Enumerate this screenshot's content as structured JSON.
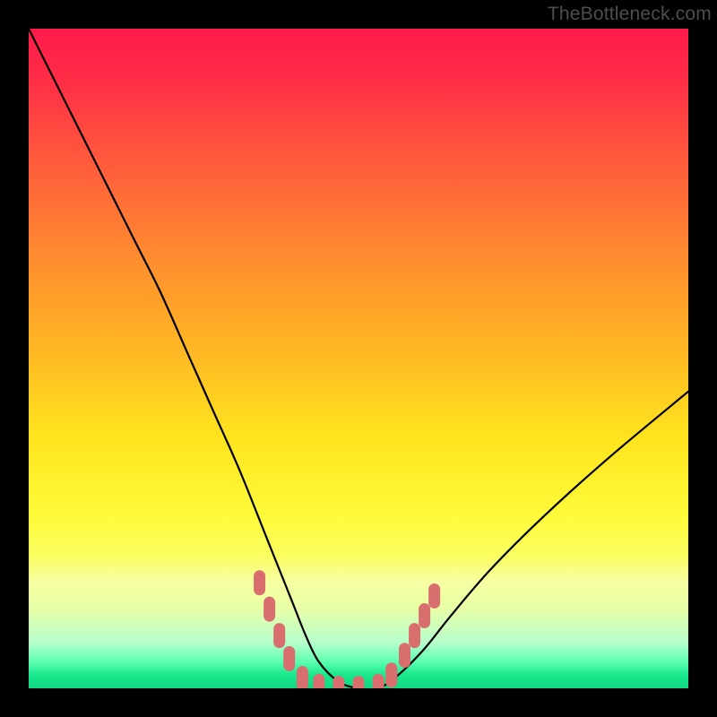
{
  "watermark": {
    "text": "TheBottleneck.com"
  },
  "chart_data": {
    "type": "line",
    "title": "",
    "xlabel": "",
    "ylabel": "",
    "xlim": [
      0,
      100
    ],
    "ylim": [
      0,
      100
    ],
    "grid": false,
    "legend": false,
    "series": [
      {
        "name": "bottleneck-curve",
        "x": [
          0,
          4,
          8,
          12,
          16,
          20,
          24,
          28,
          32,
          36,
          38,
          40,
          42,
          44,
          47,
          50,
          53,
          56,
          60,
          64,
          70,
          78,
          88,
          100
        ],
        "values": [
          100,
          92,
          84,
          76,
          68,
          60,
          51,
          42,
          33,
          23,
          18,
          13,
          8,
          4,
          1,
          0,
          0,
          2,
          6,
          11,
          18,
          26,
          35,
          45
        ]
      }
    ],
    "markers": {
      "name": "valley-markers",
      "color_hex": "#d96e6e",
      "points": [
        {
          "x": 35.0,
          "y": 16.0
        },
        {
          "x": 36.5,
          "y": 12.0
        },
        {
          "x": 38.0,
          "y": 8.0
        },
        {
          "x": 39.5,
          "y": 4.5
        },
        {
          "x": 41.5,
          "y": 1.5
        },
        {
          "x": 44.0,
          "y": 0.3
        },
        {
          "x": 47.0,
          "y": 0.0
        },
        {
          "x": 50.0,
          "y": 0.0
        },
        {
          "x": 53.0,
          "y": 0.3
        },
        {
          "x": 55.0,
          "y": 2.0
        },
        {
          "x": 57.0,
          "y": 5.0
        },
        {
          "x": 58.5,
          "y": 8.0
        },
        {
          "x": 60.0,
          "y": 11.0
        },
        {
          "x": 61.5,
          "y": 14.0
        }
      ]
    },
    "gradient_colors": {
      "top": "#ff1a4a",
      "mid": "#ffe41e",
      "bottom": "#10d880"
    }
  }
}
